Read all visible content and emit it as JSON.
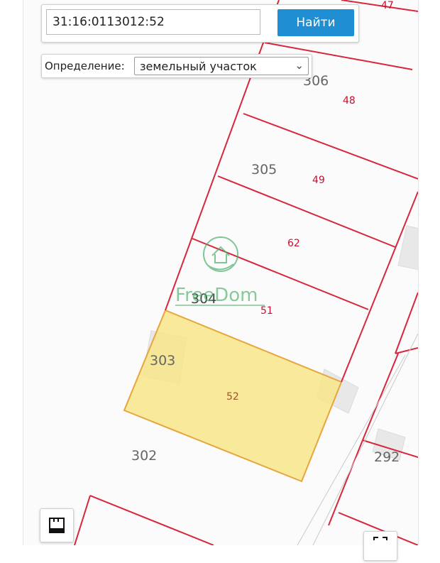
{
  "search": {
    "value": "31:16:0113012:52",
    "button_label": "Найти"
  },
  "definition": {
    "label": "Определение:",
    "selected": "земельный участок"
  },
  "map": {
    "block_labels": [
      "306",
      "305",
      "304",
      "303",
      "302",
      "292"
    ],
    "parcel_labels": [
      "47",
      "48",
      "49",
      "62",
      "51",
      "52"
    ],
    "highlight_fill": "#f7e58a",
    "highlight_stroke": "#e6a63c",
    "boundary_color": "#d7263d",
    "label_color": "#c8102e",
    "block_label_color": "#666666"
  },
  "watermark": {
    "text": "FreeDom",
    "color": "#4caf6a"
  },
  "controls": {
    "ruler_icon": "ruler-icon",
    "expand_icon": "expand-icon"
  }
}
